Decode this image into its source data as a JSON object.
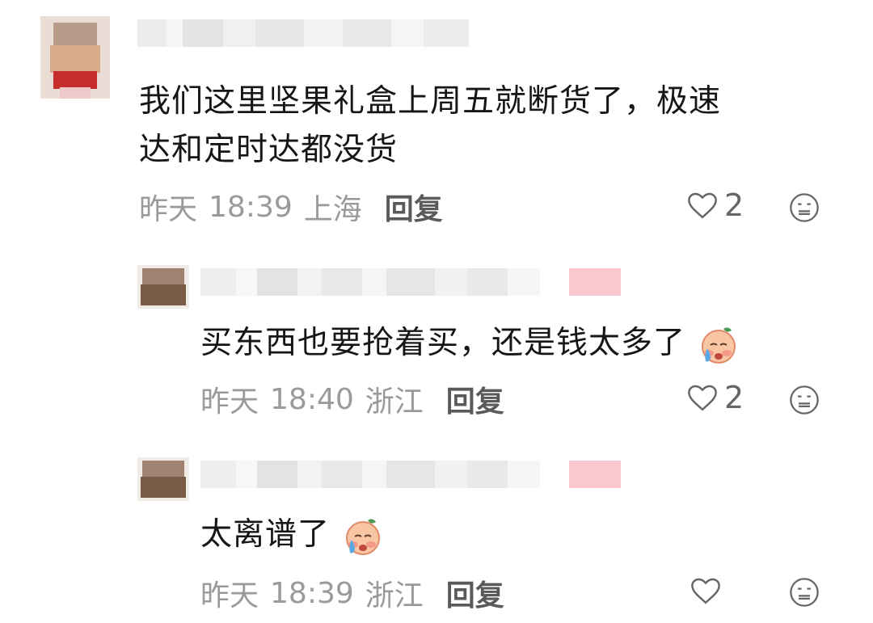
{
  "comments": [
    {
      "text_line1": "我们这里坚果礼盒上周五就断货了，极速",
      "text_line2": "达和定时达都没货",
      "date": "昨天",
      "time": "18:39",
      "location": "上海",
      "reply_label": "回复",
      "like_count": "2"
    },
    {
      "text": "买东西也要抢着买，还是钱太多了",
      "emoji": "crying-face-emoji",
      "date": "昨天",
      "time": "18:40",
      "location": "浙江",
      "reply_label": "回复",
      "like_count": "2"
    },
    {
      "text": "太离谱了",
      "emoji": "crying-face-emoji",
      "date": "昨天",
      "time": "18:39",
      "location": "浙江",
      "reply_label": "回复",
      "like_count": ""
    }
  ],
  "icons": {
    "like": "heart-icon",
    "dislike": "meh-face-icon",
    "username": "blurred-username",
    "avatar": "blurred-avatar"
  }
}
